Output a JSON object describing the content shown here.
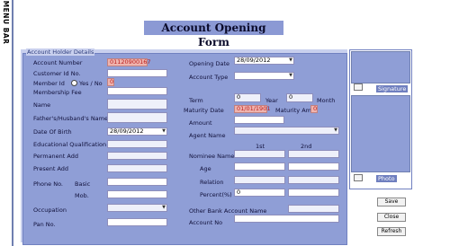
{
  "menu_bar": "MENU BAR",
  "title": "Account Opening Form",
  "section_title": "Account Holder Details",
  "left": {
    "account_number": {
      "label": "Account Number",
      "value": "01120900167"
    },
    "customer_id": {
      "label": "Customer Id No.",
      "value": ""
    },
    "member_id": {
      "label": "Member Id",
      "radio_label": "Yes / No",
      "value": "0"
    },
    "membership_fee": {
      "label": "Membership Fee",
      "value": ""
    },
    "name": {
      "label": "Name",
      "value": ""
    },
    "father_name": {
      "label": "Father's/Husband's  Name",
      "value": ""
    },
    "dob": {
      "label": "Date Of Birth",
      "value": "28/09/2012"
    },
    "education": {
      "label": "Educational Qualification",
      "value": ""
    },
    "permanent_add": {
      "label": "Permanent Add",
      "value": ""
    },
    "present_add": {
      "label": "Present Add",
      "value": ""
    },
    "phone": {
      "label": "Phone No.",
      "basic_label": "Basic",
      "mob_label": "Mob."
    },
    "occupation": {
      "label": "Occupation",
      "value": ""
    },
    "pan": {
      "label": "Pan No.",
      "value": ""
    }
  },
  "right": {
    "opening_date": {
      "label": "Opening Date",
      "value": "28/09/2012"
    },
    "account_type": {
      "label": "Account Type",
      "value": ""
    },
    "term": {
      "label": "Term",
      "value": "0",
      "year_label": "Year",
      "month_value": "0",
      "month_label": "Month"
    },
    "maturity_date": {
      "label": "Maturity Date",
      "value": "01/01/1901"
    },
    "maturity_amt": {
      "label": "Maturity Amt",
      "value": "0"
    },
    "amount": {
      "label": "Amount",
      "value": ""
    },
    "agent_name": {
      "label": "Agent Name",
      "value": ""
    },
    "col_1st": "1st",
    "col_2nd": "2nd",
    "nominee_name": {
      "label": "Nominee Name"
    },
    "age": {
      "label": "Age"
    },
    "relation": {
      "label": "Relation"
    },
    "percent": {
      "label": "Percent(%)",
      "value": "0"
    },
    "other_bank": {
      "label": "Other Bank Account Name",
      "value": ""
    },
    "account_no": {
      "label": "Account No",
      "value": ""
    }
  },
  "side": {
    "signature_label": "Signature",
    "photo_label": "Photo"
  },
  "buttons": {
    "save": "Save",
    "close": "Close",
    "refresh": "Refresh"
  }
}
